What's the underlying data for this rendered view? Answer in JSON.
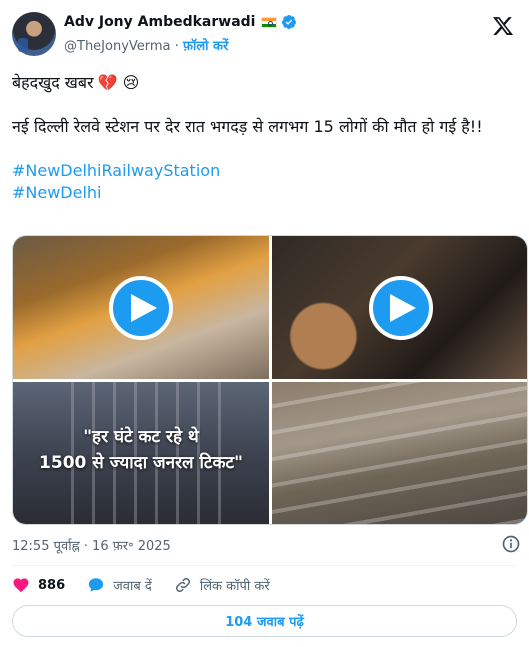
{
  "header": {
    "author_name": "Adv Jony Ambedkarwadi",
    "handle": "@TheJonyVerma",
    "separator": "·",
    "follow_label": "फ़ॉलो करें"
  },
  "tweet": {
    "line1": "बेहदखुद खबर",
    "line1_emojis": "💔 😢",
    "line2": "नई दिल्ली रेलवे स्टेशन पर देर रात भगदड़ से लगभग 15 लोगों की मौत हो गई है!!",
    "hashtags": [
      "#NewDelhiRailwayStation",
      "#NewDelhi"
    ]
  },
  "media": {
    "overlay_line1": "\"हर घंटे कट रहे थे",
    "overlay_line2": "1500 से ज्यादा जनरल टिकट\""
  },
  "timestamp": "12:55 पूर्वाह्न · 16 फ़र॰ 2025",
  "actions": {
    "like_count": "886",
    "reply_label": "जवाब दें",
    "copy_link_label": "लिंक कॉपी करें"
  },
  "read_replies_label": "104 जवाब पढ़ें",
  "colors": {
    "accent": "#1d9bf0",
    "like": "#f91880",
    "text": "#0f1419",
    "muted": "#536471"
  }
}
